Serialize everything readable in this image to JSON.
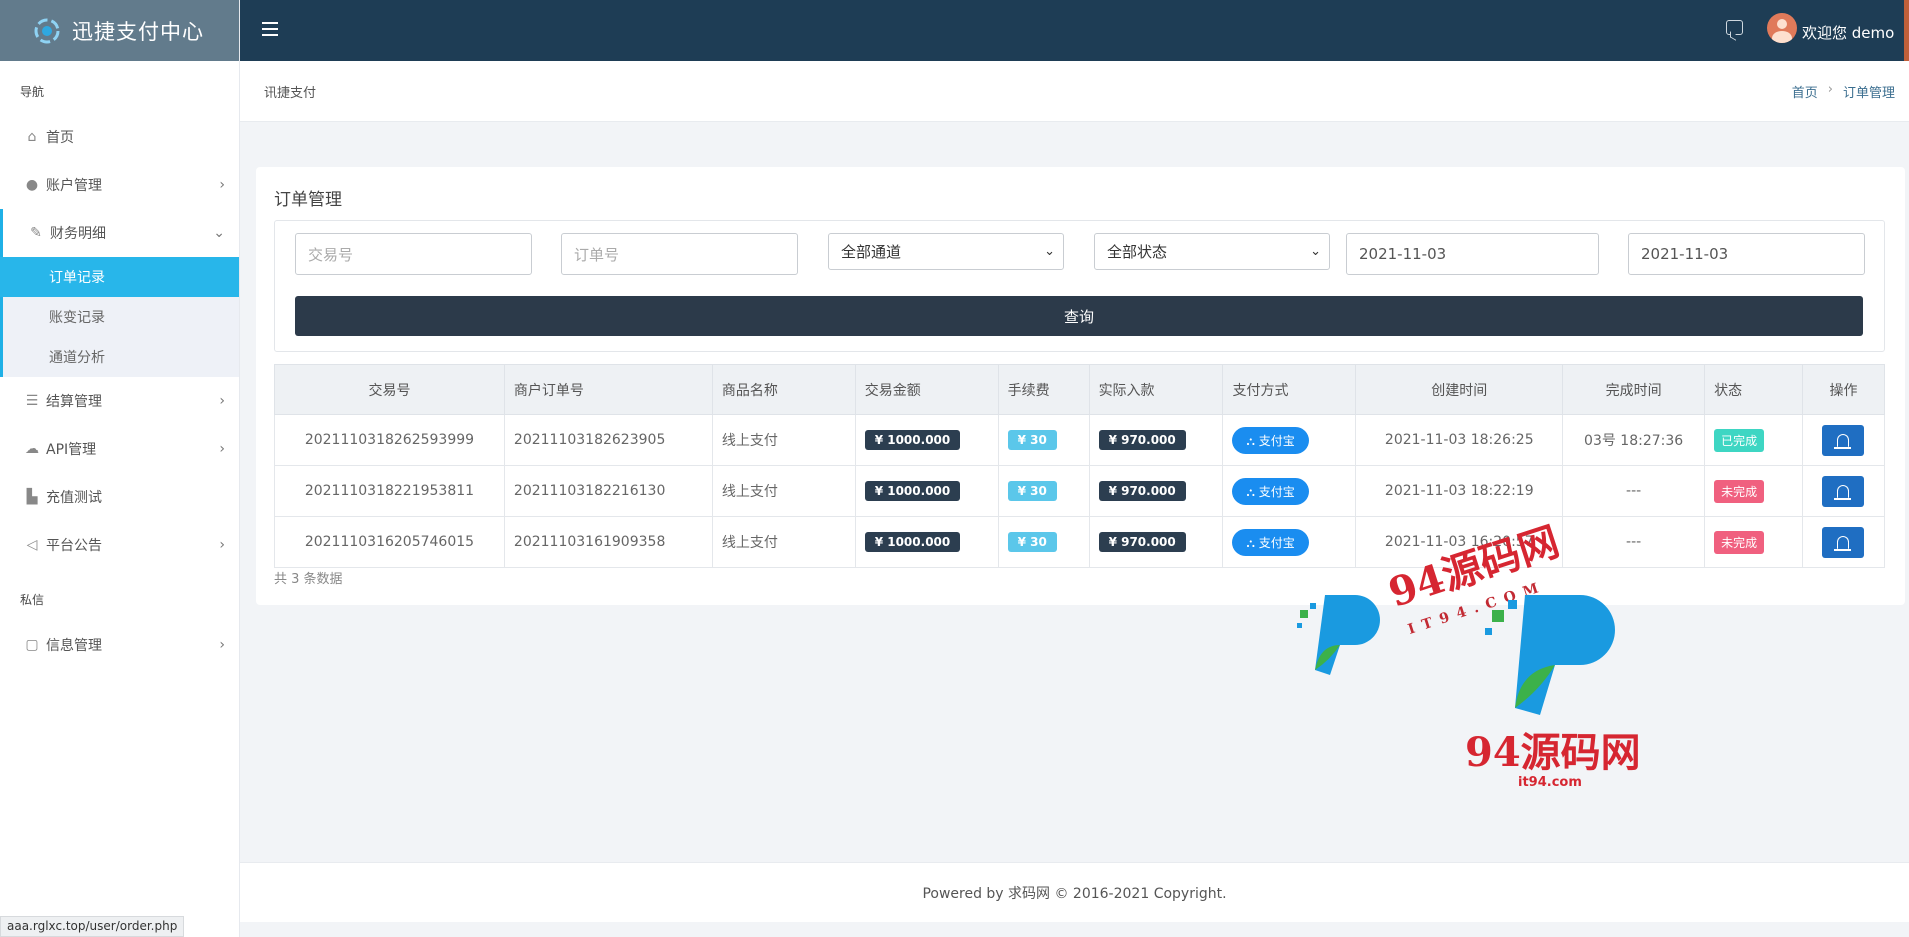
{
  "brand": {
    "title": "迅捷支付中心"
  },
  "sidebar": {
    "group_nav": "导航",
    "group_private": "私信",
    "items": [
      {
        "label": "首页",
        "icon": "home-icon"
      },
      {
        "label": "账户管理",
        "icon": "user-icon"
      },
      {
        "label": "财务明细",
        "icon": "edit-icon"
      },
      {
        "label": "结算管理",
        "icon": "list-icon"
      },
      {
        "label": "API管理",
        "icon": "cloud-icon"
      },
      {
        "label": "充值测试",
        "icon": "building-icon"
      },
      {
        "label": "平台公告",
        "icon": "speaker-icon"
      },
      {
        "label": "信息管理",
        "icon": "message-icon"
      }
    ],
    "submenu": [
      {
        "label": "订单记录"
      },
      {
        "label": "账变记录"
      },
      {
        "label": "通道分析"
      }
    ]
  },
  "header": {
    "welcome": "欢迎您 demo"
  },
  "breadcrumb": {
    "left": "讯捷支付",
    "home": "首页",
    "current": "订单管理"
  },
  "card": {
    "title": "订单管理",
    "filters": {
      "trade_no_placeholder": "交易号",
      "order_no_placeholder": "订单号",
      "channel": "全部通道",
      "status": "全部状态",
      "date_from": "2021-11-03",
      "date_to": "2021-11-03",
      "query_label": "查询"
    },
    "columns": [
      "交易号",
      "商户订单号",
      "商品名称",
      "交易金额",
      "手续费",
      "实际入款",
      "支付方式",
      "创建时间",
      "完成时间",
      "状态",
      "操作"
    ],
    "rows": [
      {
        "trade_no": "2021110318262593999",
        "order_no": "20211103182623905",
        "product": "线上支付",
        "amount": "¥ 1000.000",
        "fee": "¥ 30",
        "actual": "¥ 970.000",
        "pay": "支付宝",
        "created": "2021-11-03 18:26:25",
        "finished": "03号 18:27:36",
        "status": "已完成"
      },
      {
        "trade_no": "2021110318221953811",
        "order_no": "20211103182216130",
        "product": "线上支付",
        "amount": "¥ 1000.000",
        "fee": "¥ 30",
        "actual": "¥ 970.000",
        "pay": "支付宝",
        "created": "2021-11-03 18:22:19",
        "finished": "---",
        "status": "未完成"
      },
      {
        "trade_no": "2021110316205746015",
        "order_no": "20211103161909358",
        "product": "线上支付",
        "amount": "¥ 1000.000",
        "fee": "¥ 30",
        "actual": "¥ 970.000",
        "pay": "支付宝",
        "created": "2021-11-03 16:20:57",
        "finished": "---",
        "status": "未完成"
      }
    ],
    "total": "共 3 条数据"
  },
  "footer": {
    "text": "Powered by 求码网 © 2016-2021 Copyright."
  },
  "statusbar": {
    "url": "aaa.rglxc.top/user/order.php"
  },
  "watermark": {
    "top": "94源码网",
    "top_sub": "IT94.COM",
    "bottom": "94源码网",
    "bottom_sub": "it94.com"
  },
  "colors": {
    "header_bg": "#1e3d55",
    "brand_bg": "#627b8c",
    "accent": "#28b6ea",
    "query_btn": "#2c3a4a",
    "status_done": "#3ed6c3",
    "status_undone": "#f0607f"
  }
}
